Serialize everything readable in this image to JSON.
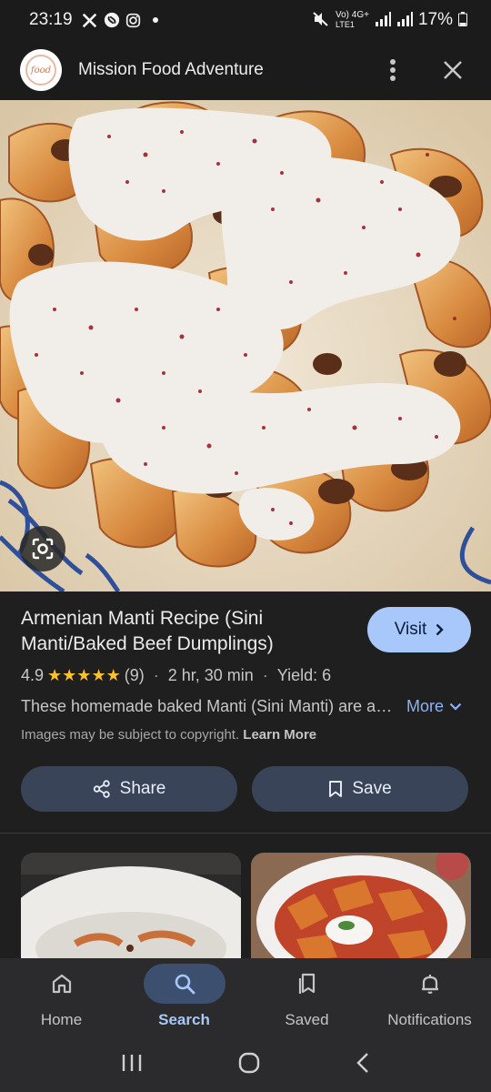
{
  "status_bar": {
    "time": "23:19",
    "left_icons": [
      "x-icon",
      "shazam-icon",
      "instagram-icon",
      "dot-icon"
    ],
    "right_icons": [
      "mute-icon",
      "volte-icon",
      "signal-icon",
      "signal-icon"
    ],
    "network_label": "Vo) 4G+",
    "network_sub": "LTE1",
    "battery": "17%"
  },
  "app_bar": {
    "logo_text": "food",
    "title": "Mission Food Adventure",
    "menu_icon": "more-vert-icon",
    "close_icon": "close-icon"
  },
  "hero": {
    "lens_icon": "lens-icon"
  },
  "result": {
    "title": "Armenian Manti Recipe (Sini Manti/Baked Beef Dumplings)",
    "visit_label": "Visit",
    "rating": "4.9",
    "stars": "★★★★★",
    "rating_count": "(9)",
    "duration": "2 hr, 30 min",
    "yield": "Yield: 6",
    "description": "These homemade baked Manti (Sini Manti) are a delicious Armenian dish",
    "more_label": "More",
    "copyright": "Images may be subject to copyright.",
    "learn_more": "Learn More",
    "share_label": "Share",
    "save_label": "Save"
  },
  "bottom_nav": {
    "items": [
      {
        "label": "Home",
        "icon": "home-icon",
        "active": false
      },
      {
        "label": "Search",
        "icon": "search-icon",
        "active": true
      },
      {
        "label": "Saved",
        "icon": "bookmarks-icon",
        "active": false
      },
      {
        "label": "Notifications",
        "icon": "bell-icon",
        "active": false
      }
    ]
  },
  "system_nav": {
    "items": [
      "recents-icon",
      "home-circle-icon",
      "back-icon"
    ]
  },
  "colors": {
    "accent": "#a8c7fa",
    "link": "#8ab4f8",
    "star": "#fbc02d",
    "chip_bg": "#394458",
    "background": "#1f1f1f"
  }
}
